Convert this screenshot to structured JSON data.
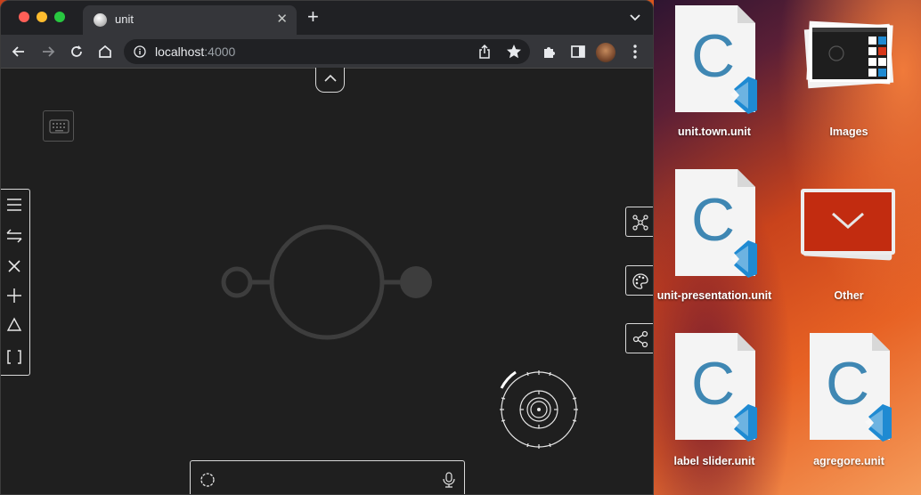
{
  "browser": {
    "tab": {
      "title": "unit"
    },
    "new_tab_label": "+",
    "address": {
      "host": "localhost",
      "port": ":4000"
    }
  },
  "app": {
    "left_toolbar": [
      "menu-icon",
      "swap-icon",
      "close-icon",
      "add-icon",
      "triangle-icon",
      "brackets-icon"
    ],
    "right_toolbar": [
      "graph-icon",
      "palette-icon",
      "share-icon"
    ]
  },
  "desktop": {
    "items": [
      {
        "label": "unit.town.unit",
        "icon": "vscode-c-file-icon"
      },
      {
        "label": "Images",
        "icon": "image-stack-icon"
      },
      {
        "label": "unit-presentation.unit",
        "icon": "vscode-c-file-icon"
      },
      {
        "label": "Other",
        "icon": "folder-stack-icon"
      },
      {
        "label": "label slider.unit",
        "icon": "vscode-c-file-icon"
      },
      {
        "label": "agregore.unit",
        "icon": "vscode-c-file-icon"
      }
    ]
  },
  "colors": {
    "browser_bg": "#1f1f1f",
    "toolbar_bg": "#35363a",
    "vscode_blue": "#1f8ad2",
    "c_letter": "#3f87b3"
  }
}
